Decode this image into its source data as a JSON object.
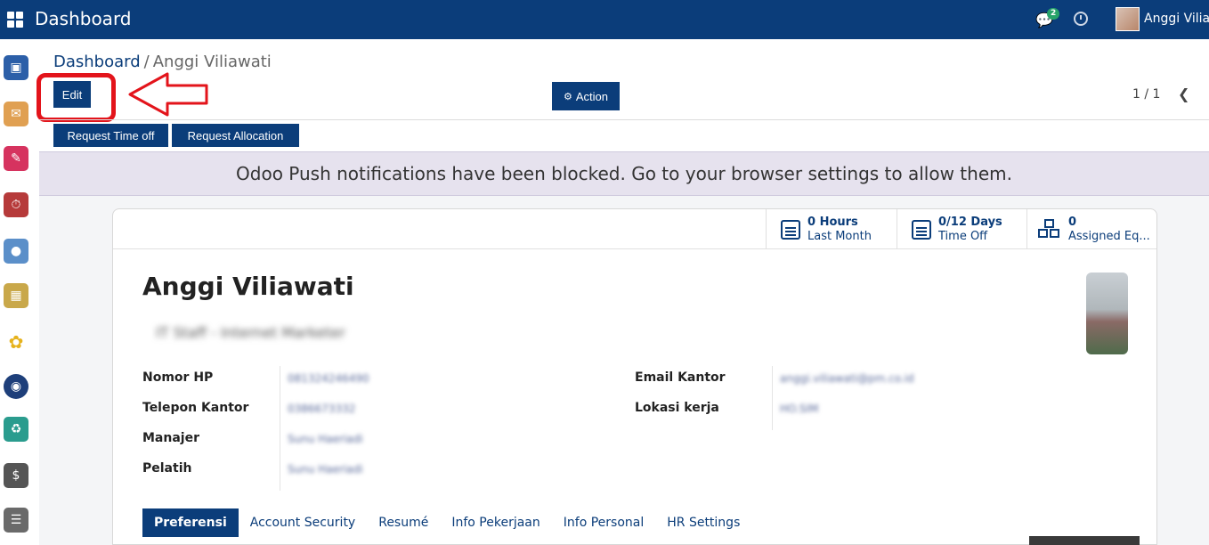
{
  "header": {
    "app_title": "Dashboard",
    "chat_badge": "2",
    "user_name": "Anggi Viliawati"
  },
  "sidebar": {
    "items": [
      {
        "icon": "monitor-icon",
        "color": "#2c5fa8"
      },
      {
        "icon": "inbox-icon",
        "color": "#e0a052"
      },
      {
        "icon": "chat-icon",
        "color": "#d6335f"
      },
      {
        "icon": "stopwatch-icon",
        "color": "#b63a3a"
      },
      {
        "icon": "user-clock-icon",
        "color": "#5b8fc9"
      },
      {
        "icon": "calendar-icon",
        "color": "#c9a84a"
      },
      {
        "icon": "leaf-icon",
        "color": "#e6b21c"
      },
      {
        "icon": "globe-icon",
        "color": "#1e3f7a"
      },
      {
        "icon": "recycle-icon",
        "color": "#2a9c8e"
      },
      {
        "icon": "user-dollar-icon",
        "color": "#555555"
      },
      {
        "icon": "note-icon",
        "color": "#6a6a6a"
      }
    ]
  },
  "breadcrumb": {
    "parent": "Dashboard",
    "separator": "/",
    "current": "Anggi Viliawati"
  },
  "toolbar": {
    "edit_label": "Edit",
    "action_label": "Action",
    "pager": "1 / 1"
  },
  "buttons": {
    "request_time_off": "Request Time off",
    "request_allocation": "Request Allocation"
  },
  "notification": "Odoo Push notifications have been blocked. Go to your browser settings to allow them.",
  "stats": [
    {
      "value": "0 Hours",
      "label": "Last Month"
    },
    {
      "value": "0/12 Days",
      "label": "Time Off"
    },
    {
      "value": "0",
      "label": "Assigned Eq..."
    }
  ],
  "employee": {
    "name": "Anggi Viliawati",
    "job_title": "IT Staff - Internet Marketer"
  },
  "fields_left": [
    {
      "label": "Nomor HP",
      "value": "081324246490"
    },
    {
      "label": "Telepon Kantor",
      "value": "0386673332"
    },
    {
      "label": "Manajer",
      "value": "Sunu Haeriadi"
    },
    {
      "label": "Pelatih",
      "value": "Sunu Haeriadi"
    }
  ],
  "fields_right": [
    {
      "label": "Email Kantor",
      "value": "anggi.viliawati@pm.co.id"
    },
    {
      "label": "Lokasi kerja",
      "value": "HO.SIM"
    }
  ],
  "tabs": [
    {
      "label": "Preferensi",
      "active": true
    },
    {
      "label": "Account Security",
      "active": false
    },
    {
      "label": "Resumé",
      "active": false
    },
    {
      "label": "Info Pekerjaan",
      "active": false
    },
    {
      "label": "Info Personal",
      "active": false
    },
    {
      "label": "HR Settings",
      "active": false
    }
  ],
  "colors": {
    "primary": "#0b3d7a",
    "annotation": "#e3141b",
    "notification_bg": "#e6e2ee"
  }
}
